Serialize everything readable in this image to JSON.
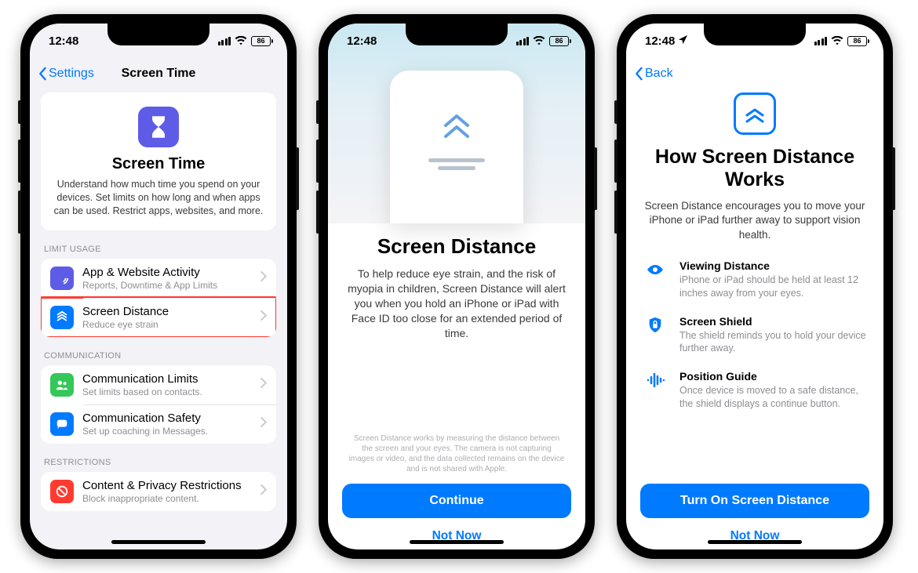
{
  "status": {
    "time": "12:48",
    "battery": "86"
  },
  "phone1": {
    "back": "Settings",
    "title": "Screen Time",
    "hero_title": "Screen Time",
    "hero_desc": "Understand how much time you spend on your devices. Set limits on how long and when apps can be used. Restrict apps, websites, and more.",
    "sect_usage": "LIMIT USAGE",
    "rows_usage": [
      {
        "title": "App & Website Activity",
        "sub": "Reports, Downtime & App Limits"
      },
      {
        "title": "Screen Distance",
        "sub": "Reduce eye strain"
      }
    ],
    "sect_comm": "COMMUNICATION",
    "rows_comm": [
      {
        "title": "Communication Limits",
        "sub": "Set limits based on contacts."
      },
      {
        "title": "Communication Safety",
        "sub": "Set up coaching in Messages."
      }
    ],
    "sect_rest": "RESTRICTIONS",
    "rows_rest": [
      {
        "title": "Content & Privacy Restrictions",
        "sub": "Block inappropriate content."
      }
    ]
  },
  "phone2": {
    "title": "Screen Distance",
    "desc": "To help reduce eye strain, and the risk of myopia in children, Screen Distance will alert you when you hold an iPhone or iPad with Face ID too close for an extended period of time.",
    "fine": "Screen Distance works by measuring the distance between the screen and your eyes. The camera is not capturing images or video, and the data collected remains on the device and is not shared with Apple.",
    "btn_primary": "Continue",
    "btn_link": "Not Now"
  },
  "phone3": {
    "back": "Back",
    "title": "How Screen Distance Works",
    "desc": "Screen Distance encourages you to move your iPhone or iPad further away to support vision health.",
    "features": [
      {
        "title": "Viewing Distance",
        "desc": "iPhone or iPad should be held at least 12 inches away from your eyes."
      },
      {
        "title": "Screen Shield",
        "desc": "The shield reminds you to hold your device further away."
      },
      {
        "title": "Position Guide",
        "desc": "Once device is moved to a safe distance, the shield displays a continue button."
      }
    ],
    "btn_primary": "Turn On Screen Distance",
    "btn_link": "Not Now"
  }
}
